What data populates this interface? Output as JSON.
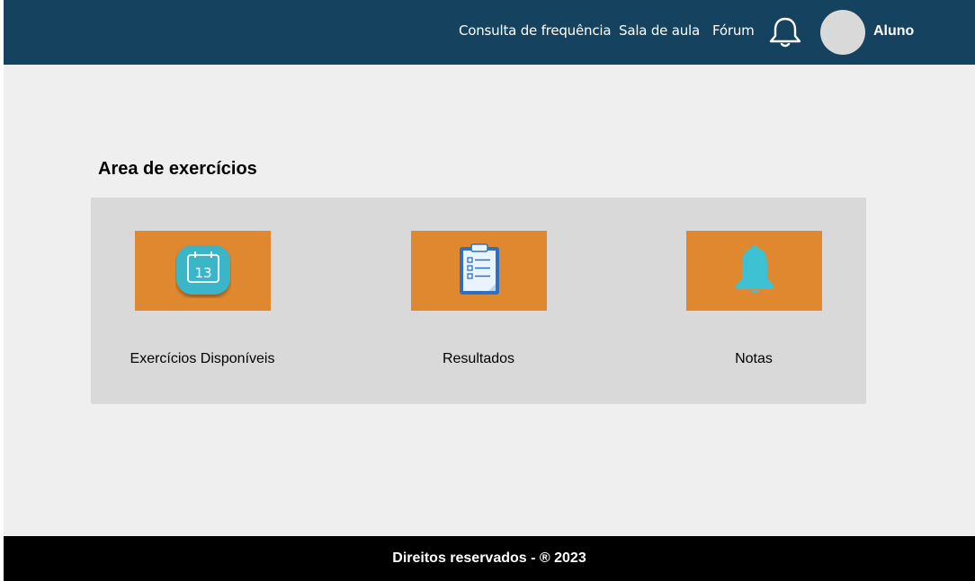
{
  "navbar": {
    "links": [
      {
        "label": "Consulta de frequência"
      },
      {
        "label": "Sala de aula"
      },
      {
        "label": "Fórum"
      }
    ],
    "notification_icon": "bell-outline-icon",
    "user": {
      "name": "Aluno"
    },
    "background_color": "#15425f"
  },
  "main": {
    "section_title": "Area de exercícios",
    "cards": [
      {
        "label": "Exercícios Disponíveis",
        "icon": "calendar-icon",
        "icon_text": "13"
      },
      {
        "label": "Resultados",
        "icon": "clipboard-checklist-icon"
      },
      {
        "label": "Notas",
        "icon": "bell-icon"
      }
    ],
    "card_color": "#e08830",
    "panel_color": "#d9d9d9"
  },
  "footer": {
    "text": "Direitos reservados - ® 2023"
  }
}
